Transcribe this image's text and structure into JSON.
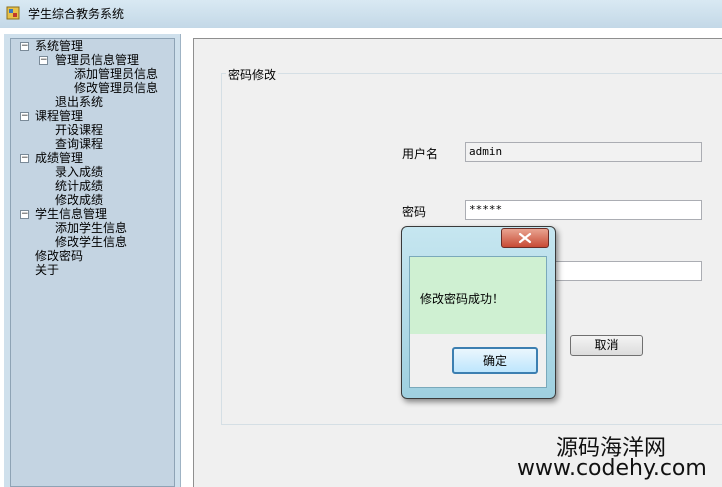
{
  "window": {
    "title": "学生综合教务系统"
  },
  "tree": {
    "items": [
      {
        "label": "系统管理",
        "expanded": true
      },
      {
        "label": "管理员信息管理",
        "expanded": true
      },
      {
        "label": "添加管理员信息"
      },
      {
        "label": "修改管理员信息"
      },
      {
        "label": "退出系统"
      },
      {
        "label": "课程管理",
        "expanded": true
      },
      {
        "label": "开设课程"
      },
      {
        "label": "查询课程"
      },
      {
        "label": "成绩管理",
        "expanded": true
      },
      {
        "label": "录入成绩"
      },
      {
        "label": "统计成绩"
      },
      {
        "label": "修改成绩"
      },
      {
        "label": "学生信息管理",
        "expanded": true
      },
      {
        "label": "添加学生信息"
      },
      {
        "label": "修改学生信息"
      },
      {
        "label": "修改密码"
      },
      {
        "label": "关于"
      }
    ],
    "toggle_symbol": "−"
  },
  "form": {
    "group_title": "密码修改",
    "username_label": "用户名",
    "username_value": "admin",
    "password_label": "密码",
    "password_value": "*****",
    "cancel_label": "取消"
  },
  "dialog": {
    "message": "修改密码成功！",
    "ok_label": "确定"
  },
  "watermark": {
    "line1": "源码海洋网",
    "line2": "www.codehy.com"
  },
  "colors": {
    "dialog_message_bg": "#cff0d2",
    "close_button": "#c74b35"
  },
  "icons": {
    "close": "close-icon",
    "app": "app-icon"
  }
}
